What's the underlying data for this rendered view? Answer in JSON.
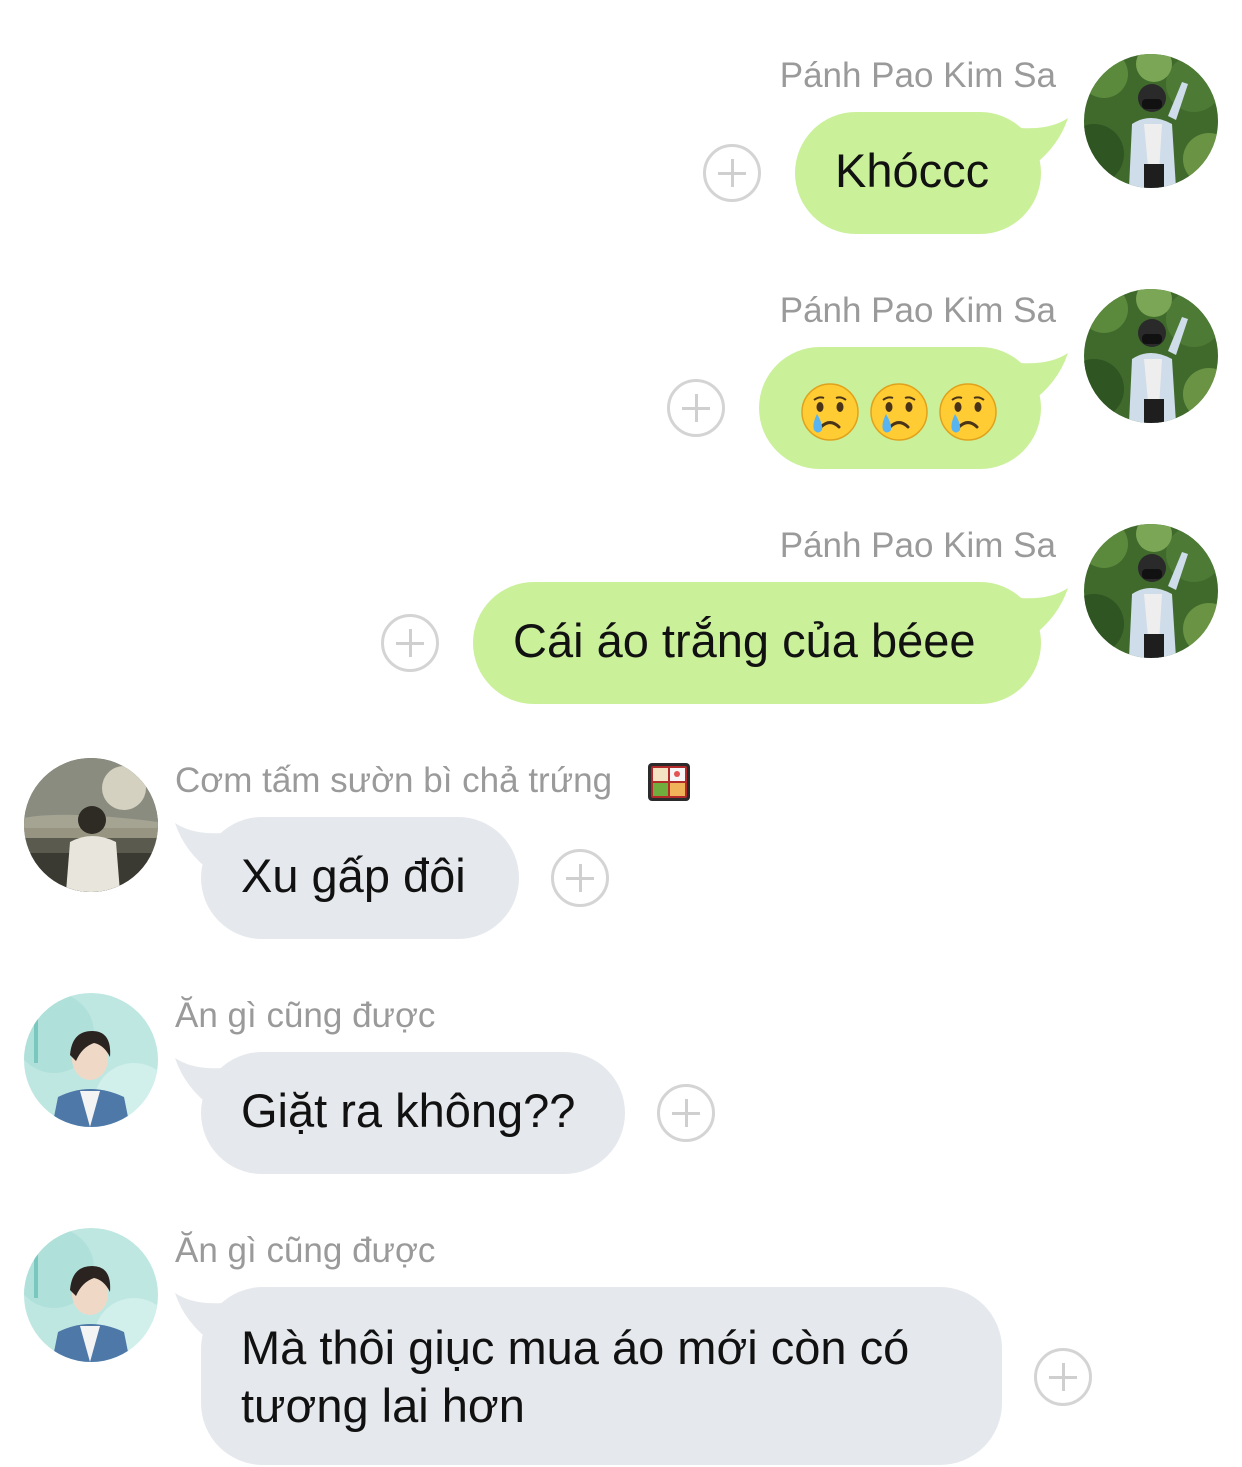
{
  "messages": [
    {
      "id": 1,
      "side": "right",
      "sender": "Pánh Pao Kim Sa",
      "text": "Khóccc",
      "avatar": "avatar-photo-boy-mask-outdoor-icon"
    },
    {
      "id": 2,
      "side": "right",
      "sender": "Pánh Pao Kim Sa",
      "emoji": [
        "crying-face-emoji",
        "crying-face-emoji",
        "crying-face-emoji"
      ],
      "avatar": "avatar-photo-boy-mask-outdoor-icon"
    },
    {
      "id": 3,
      "side": "right",
      "sender": "Pánh Pao Kim Sa",
      "text": "Cái áo trắng của béee",
      "avatar": "avatar-photo-boy-mask-outdoor-icon"
    },
    {
      "id": 4,
      "side": "left",
      "sender": "Cơm tấm sườn bì chả trứng",
      "sender_emoji": "bento-box-emoji",
      "text": "Xu gấp đôi",
      "avatar": "avatar-photo-sunset-lake-icon"
    },
    {
      "id": 5,
      "side": "left",
      "sender": "Ăn gì cũng được",
      "text": "Giặt ra không??",
      "avatar": "avatar-photo-idol-mint-icon"
    },
    {
      "id": 6,
      "side": "left",
      "sender": "Ăn gì cũng được",
      "text_lines": [
        "Mà thôi giục mua áo mới còn có",
        "tương lai hơn"
      ],
      "avatar": "avatar-photo-idol-mint-icon"
    }
  ],
  "colors": {
    "outgoing_bubble": "#cbf09a",
    "incoming_bubble": "#e5e8ec",
    "sender_name": "#9a9a9a",
    "plus_button": "#d4d4d4"
  },
  "icons": {
    "add_reaction": "plus-circle-icon"
  }
}
